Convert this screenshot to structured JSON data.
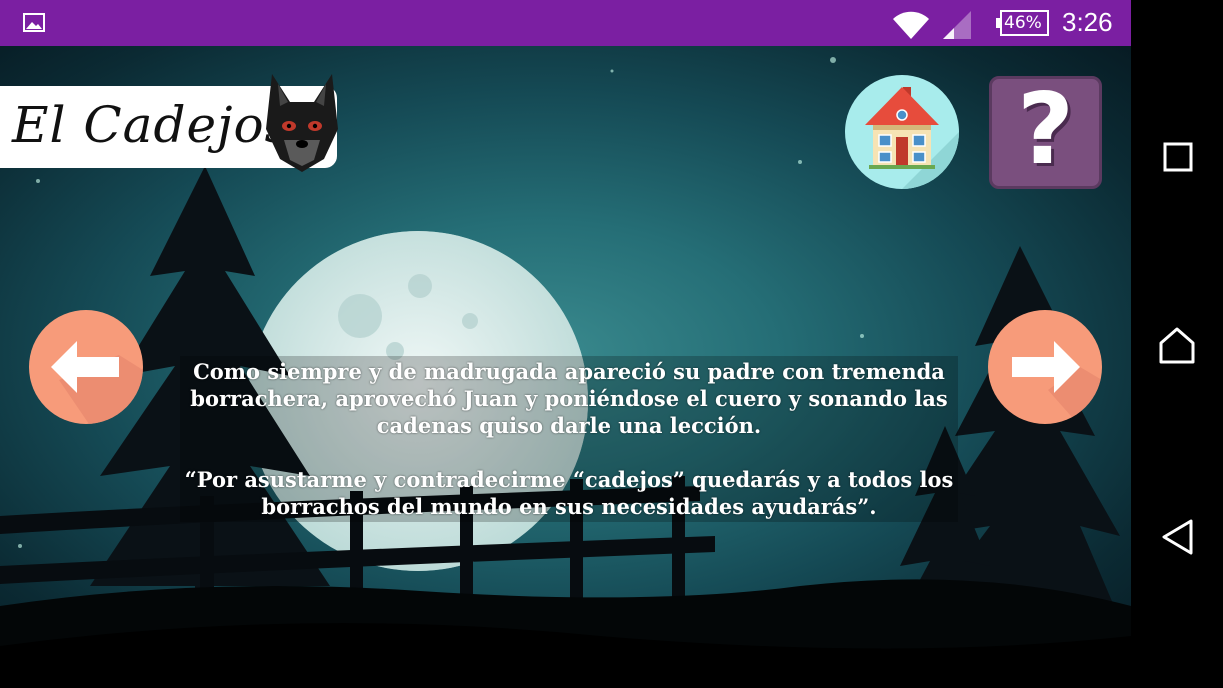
{
  "status_bar": {
    "battery": "46%",
    "time": "3:26",
    "icons": [
      "gallery-icon",
      "wifi-icon",
      "signal-icon",
      "battery-icon"
    ],
    "background": "#7b1fa2"
  },
  "title": {
    "text": "El Cadejos",
    "mascot_icon": "wolf-icon"
  },
  "buttons": {
    "home_icon": "house-icon",
    "help_label": "?",
    "prev_icon": "arrow-left-icon",
    "next_icon": "arrow-right-icon"
  },
  "story": {
    "paragraph_1": "Como siempre y de madrugada apareció su padre con tremenda borrachera, aprovechó Juan y poniéndose el cuero y sonando las cadenas quiso darle una lección.",
    "paragraph_2": "“Por asustarme y contradecirme “cadejos” quedarás y a todos los borrachos del mundo en sus necesidades ayudarás”."
  },
  "nav_bar": {
    "icons": [
      "recents-icon",
      "home-icon",
      "back-icon"
    ]
  },
  "colors": {
    "accent": "#7b1fa2",
    "nav_button": "#f79b7a",
    "home_button": "#a8ecec",
    "help_button": "#7a4f7e"
  }
}
